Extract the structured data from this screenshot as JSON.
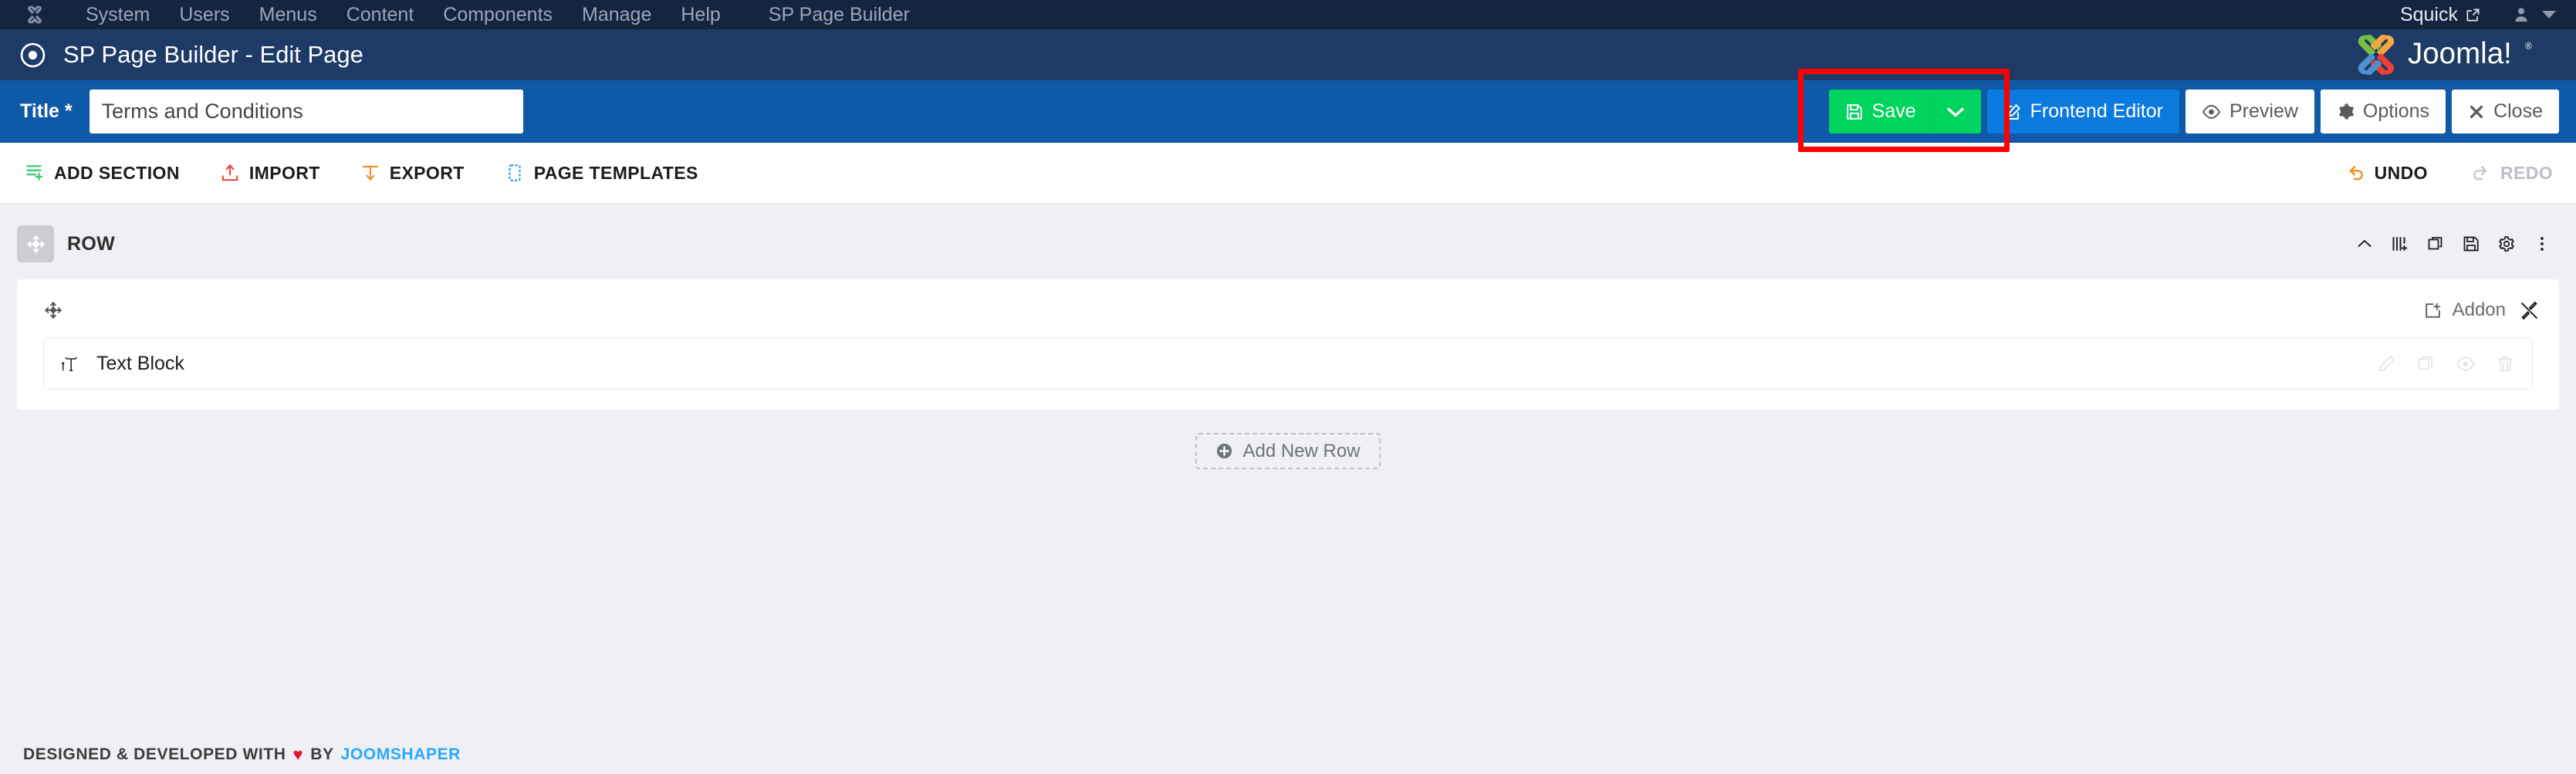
{
  "admin_bar": {
    "logo_icon": "joomla-icon",
    "menu": [
      {
        "label": "System"
      },
      {
        "label": "Users"
      },
      {
        "label": "Menus"
      },
      {
        "label": "Content"
      },
      {
        "label": "Components"
      },
      {
        "label": "Manage"
      },
      {
        "label": "Help"
      },
      {
        "label": "SP Page Builder"
      }
    ],
    "site_name": "Squick",
    "external_link_icon": "external-link-icon",
    "user_icon": "user-icon",
    "caret_icon": "chevron-down-icon"
  },
  "subhead": {
    "icon": "circle-dot-icon",
    "title": "SP Page Builder - Edit Page",
    "logo_alt": "Joomla!",
    "logo_registered": "®"
  },
  "titlebar": {
    "title_label": "Title *",
    "title_value": "Terms and Conditions",
    "title_placeholder": "Title",
    "buttons": {
      "save": "Save",
      "save_icon": "floppy-disk-icon",
      "save_caret_icon": "chevron-down-icon",
      "frontend_editor": "Frontend Editor",
      "frontend_editor_icon": "pencil-square-icon",
      "preview": "Preview",
      "preview_icon": "eye-icon",
      "options": "Options",
      "options_icon": "gear-icon",
      "close": "Close",
      "close_icon": "times-icon"
    },
    "highlight_color": "#fe0000",
    "save_color": "#00d45e",
    "frontend_color": "#0b7ade",
    "bar_color": "#0f5aa8"
  },
  "builder_bar": {
    "left": [
      {
        "label": "ADD SECTION",
        "icon": "add-section-icon",
        "color": "#2ecc71"
      },
      {
        "label": "IMPORT",
        "icon": "import-icon",
        "color": "#e74c3c"
      },
      {
        "label": "EXPORT",
        "icon": "export-icon",
        "color": "#f0932b"
      },
      {
        "label": "PAGE TEMPLATES",
        "icon": "page-templates-icon",
        "color": "#2b9cf0"
      }
    ],
    "right": [
      {
        "label": "UNDO",
        "icon": "undo-icon",
        "color": "#f0932b",
        "disabled": false
      },
      {
        "label": "REDO",
        "icon": "redo-icon",
        "color": "#c7c9ce",
        "disabled": true
      }
    ]
  },
  "canvas": {
    "row": {
      "drag_icon": "move-arrows-icon",
      "label": "ROW",
      "actions": [
        {
          "icon": "chevron-up-icon",
          "name": "collapse-row"
        },
        {
          "icon": "add-column-icon",
          "name": "add-column"
        },
        {
          "icon": "duplicate-icon",
          "name": "duplicate-row"
        },
        {
          "icon": "save-icon",
          "name": "save-row"
        },
        {
          "icon": "gear-icon",
          "name": "row-settings"
        },
        {
          "icon": "ellipsis-vertical-icon",
          "name": "row-more-menu"
        }
      ]
    },
    "column": {
      "drag_icon": "move-arrows-icon",
      "addon_label": "Addon",
      "addon_icon": "add-box-icon",
      "tools_icon": "tools-icon"
    },
    "addon": {
      "icon": "text-block-icon",
      "name": "Text Block",
      "tools": [
        {
          "icon": "pencil-icon",
          "name": "edit-addon"
        },
        {
          "icon": "duplicate-icon",
          "name": "duplicate-addon"
        },
        {
          "icon": "eye-icon",
          "name": "preview-addon"
        },
        {
          "icon": "trash-icon",
          "name": "delete-addon"
        }
      ]
    },
    "add_new_row": {
      "label": "Add New Row",
      "icon": "plus-circle-icon"
    }
  },
  "footer": {
    "prefix": "DESIGNED & DEVELOPED WITH",
    "heart": "♥",
    "by": "BY",
    "brand": "JOOMSHAPER",
    "brand_color": "#29a9ff"
  }
}
